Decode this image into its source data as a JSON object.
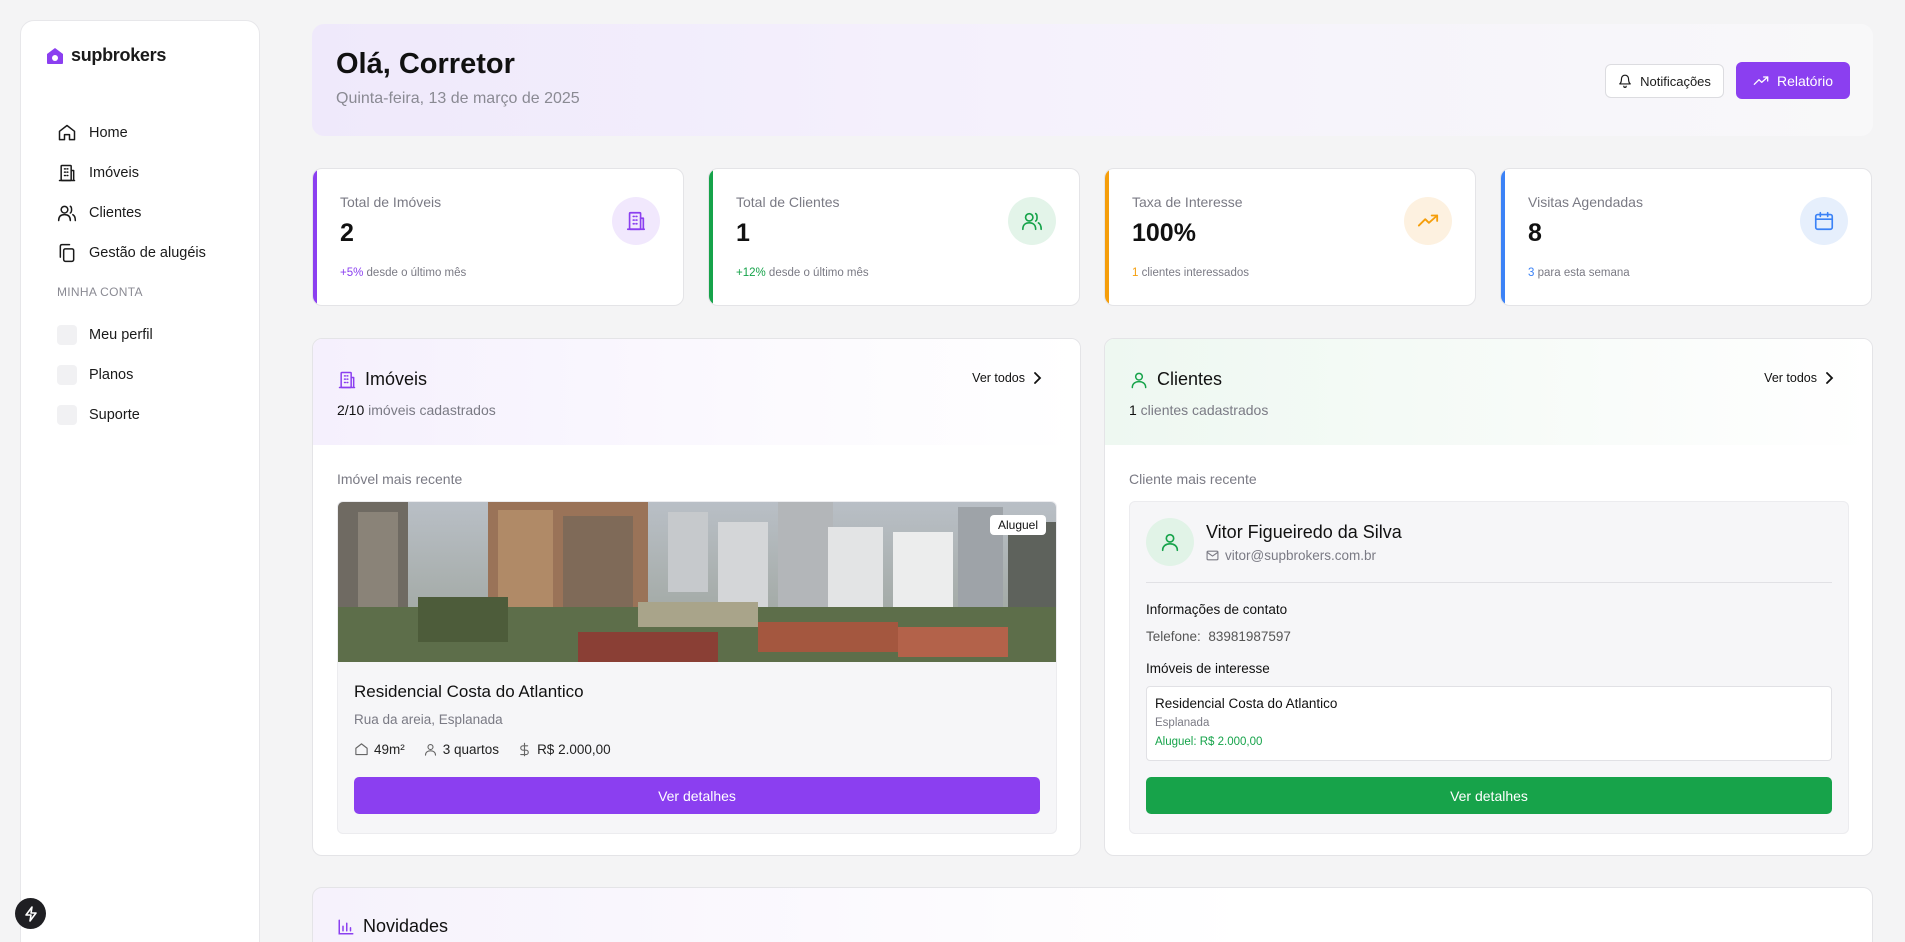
{
  "app": {
    "logo_text": "supbrokers"
  },
  "sidebar": {
    "items": [
      {
        "label": "Home",
        "icon": "home-icon"
      },
      {
        "label": "Imóveis",
        "icon": "building-icon"
      },
      {
        "label": "Clientes",
        "icon": "users-icon"
      },
      {
        "label": "Gestão de alugéis",
        "icon": "copy-icon"
      }
    ],
    "section_label": "MINHA CONTA",
    "account_items": [
      {
        "label": "Meu perfil"
      },
      {
        "label": "Planos"
      },
      {
        "label": "Suporte"
      }
    ]
  },
  "header": {
    "greeting": "Olá, Corretor",
    "date": "Quinta-feira, 13 de março de 2025",
    "notifications_label": "Notificações",
    "report_label": "Relatório"
  },
  "stats": [
    {
      "label": "Total de Imóveis",
      "value": "2",
      "highlight": "+5%",
      "foot": " desde o último mês",
      "accent": "#8b3ff0",
      "soft": "#f1e8fd",
      "icon": "building-icon"
    },
    {
      "label": "Total de Clientes",
      "value": "1",
      "highlight": "+12%",
      "foot": " desde o último mês",
      "accent": "#16a34a",
      "soft": "#e3f4e9",
      "icon": "users-icon"
    },
    {
      "label": "Taxa de Interesse",
      "value": "100%",
      "highlight": "1",
      "foot": " clientes interessados",
      "accent": "#f59e0b",
      "soft": "#fdf1e0",
      "icon": "trending-up-icon"
    },
    {
      "label": "Visitas Agendadas",
      "value": "8",
      "highlight": "3",
      "foot": " para esta semana",
      "accent": "#3b82f6",
      "soft": "#e6effc",
      "icon": "calendar-icon"
    }
  ],
  "properties_panel": {
    "title": "Imóveis",
    "count": "2/10",
    "count_suffix": " imóveis cadastrados",
    "see_all": "Ver todos",
    "recent_label": "Imóvel mais recente",
    "property": {
      "badge": "Aluguel",
      "name": "Residencial Costa do Atlantico",
      "address": "Rua da areia, Esplanada",
      "area": "49m²",
      "rooms": "3 quartos",
      "price": "R$ 2.000,00",
      "button": "Ver detalhes"
    }
  },
  "clients_panel": {
    "title": "Clientes",
    "count": "1",
    "count_suffix": " clientes cadastrados",
    "see_all": "Ver todos",
    "recent_label": "Cliente mais recente",
    "client": {
      "name": "Vitor Figueiredo da Silva",
      "email": "vitor@supbrokers.com.br",
      "contact_title": "Informações de contato",
      "phone_label": "Telefone:",
      "phone": "83981987597",
      "interests_title": "Imóveis de interesse",
      "interest": {
        "name": "Residencial Costa do Atlantico",
        "location": "Esplanada",
        "price": "Aluguel: R$ 2.000,00"
      },
      "button": "Ver detalhes"
    }
  },
  "news": {
    "title": "Novidades"
  }
}
